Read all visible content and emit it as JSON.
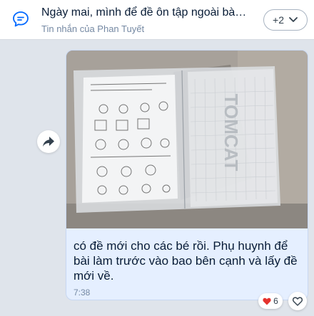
{
  "pinned": {
    "title": "Ngày mai, mình để đề ôn tập ngoài bàn ...",
    "subtitle": "Tin nhắn của Phan Tuyết",
    "more_label": "+2",
    "icon": "chat-bubble-icon",
    "chevron_icon": "chevron-down-icon"
  },
  "message": {
    "photo_text": "TOMCAT",
    "text": "có đề mới cho các bé rồi. Phụ huynh để bài làm trước vào bao bên cạnh và lấy đề mới về.",
    "time": "7:38",
    "share_icon": "share-icon"
  },
  "reactions": {
    "count": "6",
    "reaction_icon": "heart-icon",
    "add_icon": "heart-outline-icon"
  },
  "colors": {
    "bubble_bg": "#e5efff",
    "accent": "#0068ff",
    "heart": "#e5322d"
  }
}
